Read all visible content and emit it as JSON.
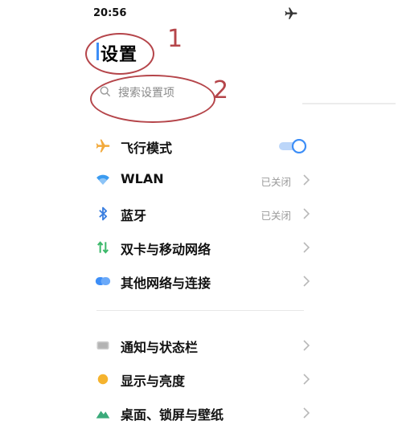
{
  "status_bar": {
    "time": "20:56",
    "mode_icon": "airplane-icon"
  },
  "page": {
    "title": "设置"
  },
  "search": {
    "placeholder": "搜索设置项"
  },
  "annotations": {
    "one": "1",
    "two": "2",
    "color": "#b5454a"
  },
  "accent_color": "#3d8ef7",
  "settings": {
    "items": [
      {
        "label": "飞行模式",
        "icon": "airplane-icon",
        "toggle": "on"
      },
      {
        "label": "WLAN",
        "icon": "wifi-icon",
        "status": "已关闭"
      },
      {
        "label": "蓝牙",
        "icon": "bluetooth-icon",
        "status": "已关闭"
      },
      {
        "label": "双卡与移动网络",
        "icon": "mobile-data-icon"
      },
      {
        "label": "其他网络与连接",
        "icon": "network-icon"
      },
      {
        "label": "通知与状态栏",
        "icon": "notification-icon"
      },
      {
        "label": "显示与亮度",
        "icon": "brightness-icon"
      },
      {
        "label": "桌面、锁屏与壁纸",
        "icon": "wallpaper-icon"
      }
    ]
  }
}
